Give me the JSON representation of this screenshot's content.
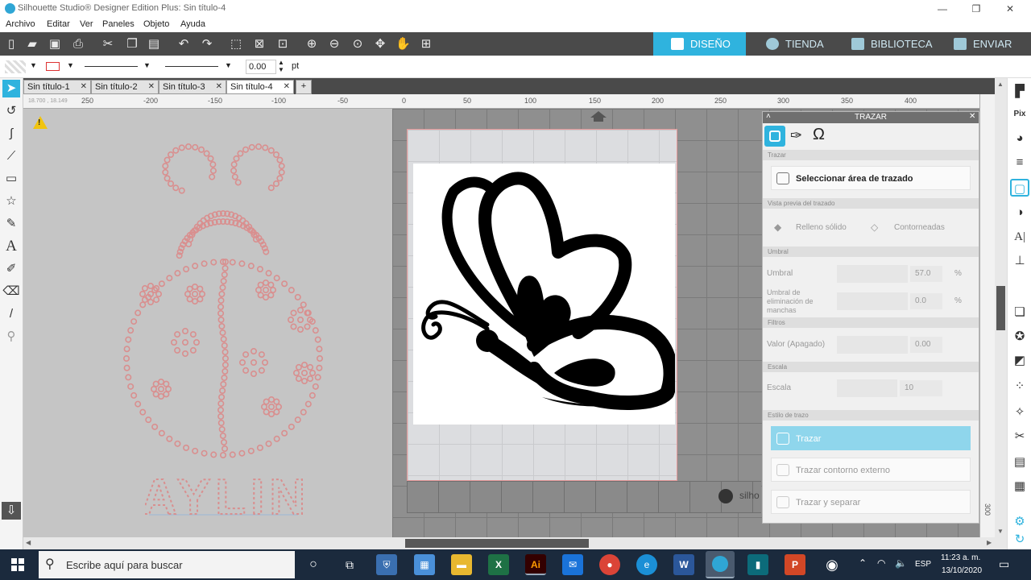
{
  "window": {
    "title": "Silhouette Studio® Designer Edition Plus: Sin título-4",
    "controls": [
      "—",
      "❐",
      "✕"
    ]
  },
  "menu": [
    "Archivo",
    "Editar",
    "Ver",
    "Paneles",
    "Objeto",
    "Ayuda"
  ],
  "nav_tabs": [
    "DISEÑO",
    "TIENDA",
    "BIBLIOTECA",
    "ENVIAR"
  ],
  "property_bar": {
    "line_width": "0.00",
    "unit": "pt"
  },
  "doc_tabs": [
    "Sin título-1",
    "Sin título-2",
    "Sin título-3",
    "Sin título-4"
  ],
  "ruler": {
    "coords": "18.700 , 18.149",
    "h_ticks": [
      "250",
      "-200",
      "-150",
      "-100",
      "-50",
      "0",
      "50",
      "100",
      "150",
      "200",
      "250",
      "300",
      "350",
      "400"
    ],
    "v_ticks": [
      "300"
    ]
  },
  "canvas": {
    "design_text": "AYLIN",
    "watermark": "silho"
  },
  "trazar_panel": {
    "title": "TRAZAR",
    "section_trazar": "Trazar",
    "select_area": "Seleccionar área de trazado",
    "section_preview": "Vista previa del trazado",
    "solid_fill": "Relleno sólido",
    "outlined": "Contorneadas",
    "section_threshold": "Umbral",
    "threshold_label": "Umbral",
    "threshold_value": "57.0",
    "threshold_unit": "%",
    "spot_label": "Umbral de eliminación de manchas",
    "spot_value": "0.0",
    "spot_unit": "%",
    "section_filters": "Filtros",
    "filter_label": "Valor (Apagado)",
    "filter_value": "0.00",
    "section_scale": "Escala",
    "scale_label": "Escala",
    "scale_value": "10",
    "section_style": "Estilo de trazo",
    "trace": "Trazar",
    "trace_outer": "Trazar contorno externo",
    "trace_separate": "Trazar y separar"
  },
  "taskbar": {
    "search_placeholder": "Escribe aquí para buscar",
    "lang": "ESP",
    "time": "11:23 a. m.",
    "date": "13/10/2020"
  },
  "colors": {
    "accent": "#2fb3de",
    "toolbar": "#4a4a4a",
    "rhinestone": "#d98f8f",
    "taskbar": "#1b2a3d"
  }
}
